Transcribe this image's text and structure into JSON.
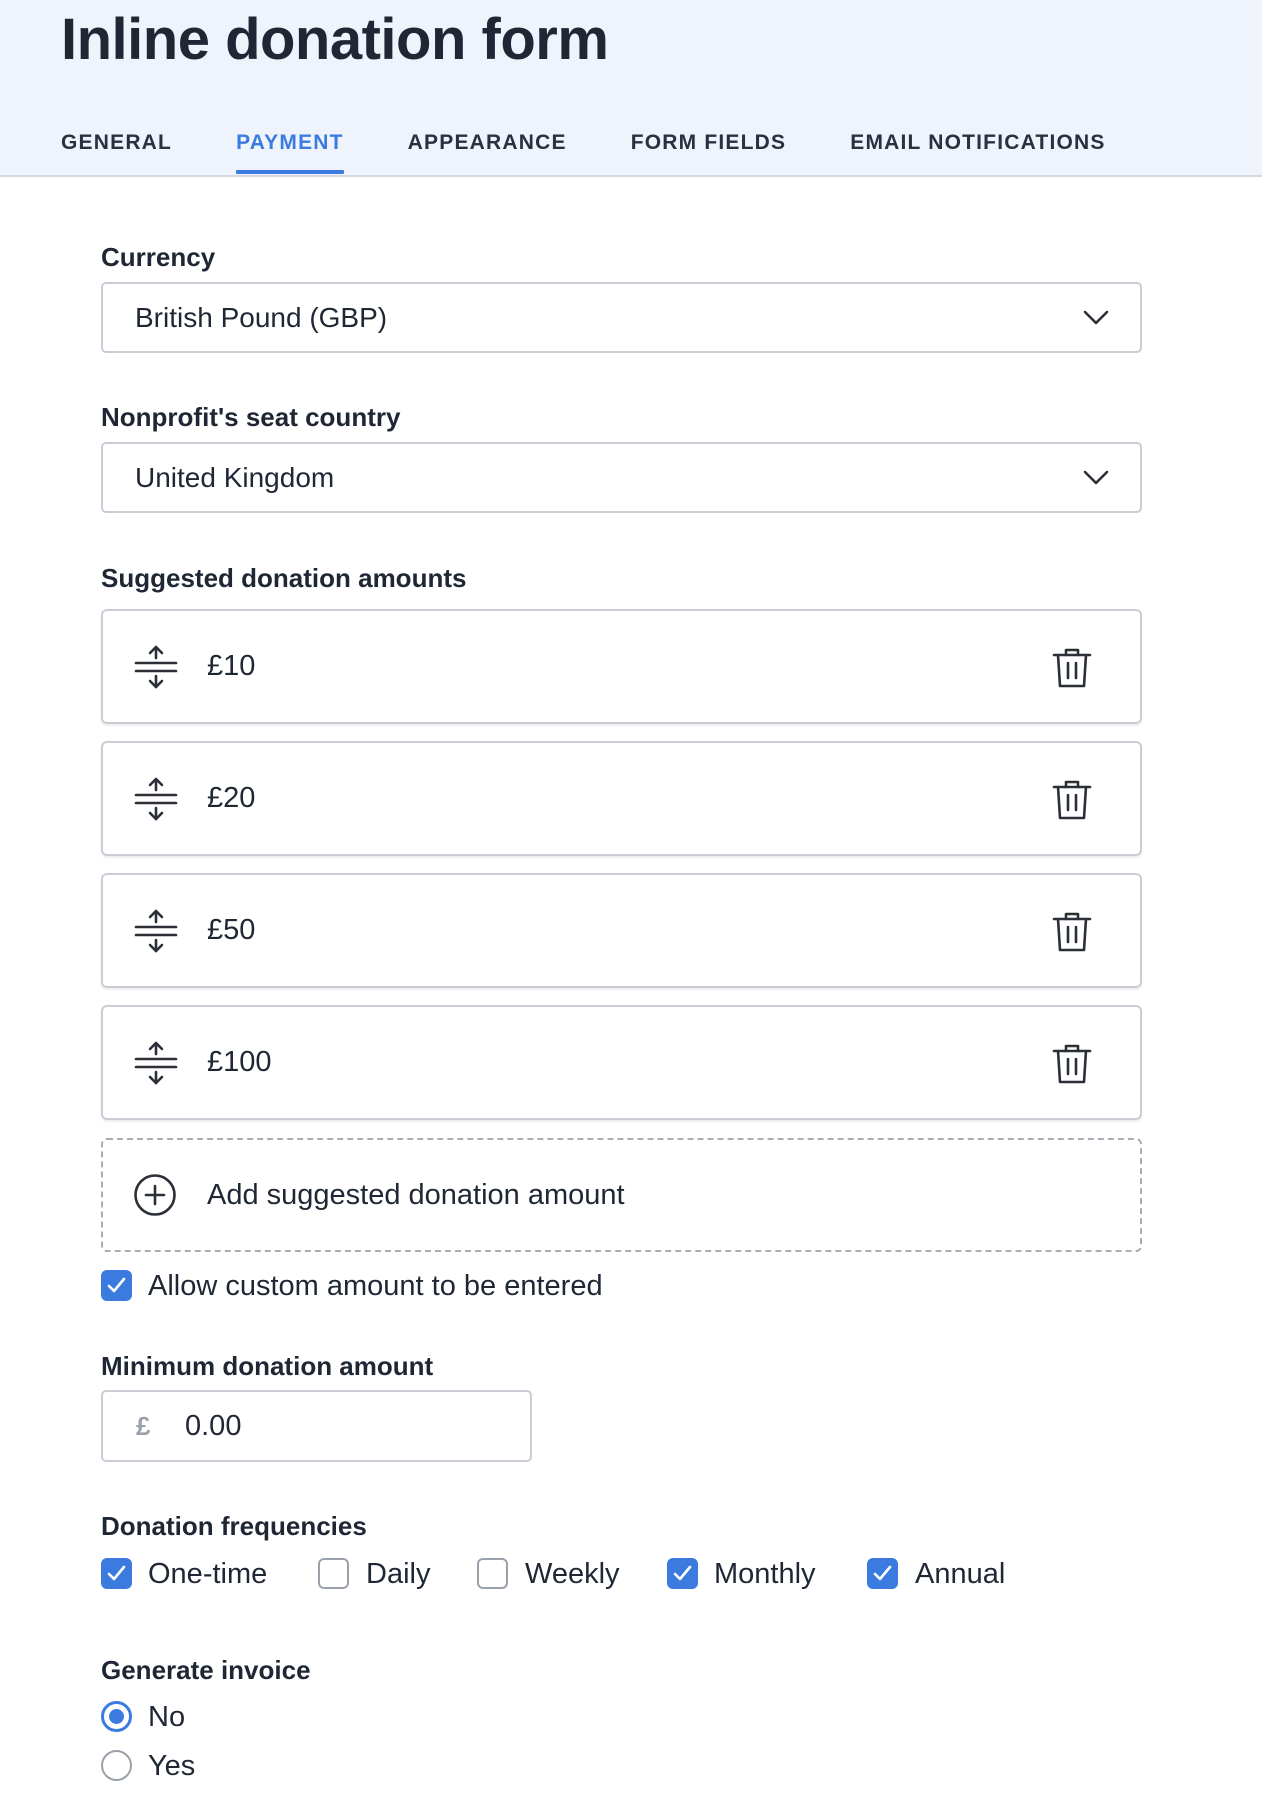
{
  "header": {
    "title": "Inline donation form",
    "tabs": [
      {
        "label": "GENERAL",
        "active": false
      },
      {
        "label": "PAYMENT",
        "active": true
      },
      {
        "label": "APPEARANCE",
        "active": false
      },
      {
        "label": "FORM FIELDS",
        "active": false
      },
      {
        "label": "EMAIL NOTIFICATIONS",
        "active": false
      }
    ]
  },
  "currency": {
    "label": "Currency",
    "value": "British Pound (GBP)"
  },
  "seat_country": {
    "label": "Nonprofit's seat country",
    "value": "United Kingdom"
  },
  "suggested": {
    "label": "Suggested donation amounts",
    "amounts": [
      "£10",
      "£20",
      "£50",
      "£100"
    ],
    "add_label": "Add suggested donation amount"
  },
  "custom_amount": {
    "label": "Allow custom amount to be entered",
    "checked": true
  },
  "minimum": {
    "label": "Minimum donation amount",
    "currency_symbol": "£",
    "value": "0.00"
  },
  "frequencies": {
    "label": "Donation frequencies",
    "options": [
      {
        "label": "One-time",
        "checked": true
      },
      {
        "label": "Daily",
        "checked": false
      },
      {
        "label": "Weekly",
        "checked": false
      },
      {
        "label": "Monthly",
        "checked": true
      },
      {
        "label": "Annual",
        "checked": true
      }
    ]
  },
  "invoice": {
    "label": "Generate invoice",
    "options": [
      {
        "label": "No",
        "selected": true
      },
      {
        "label": "Yes",
        "selected": false
      }
    ]
  },
  "colors": {
    "accent": "#3b7be0",
    "header_bg": "#eff4fc",
    "border": "#c9ced6"
  }
}
